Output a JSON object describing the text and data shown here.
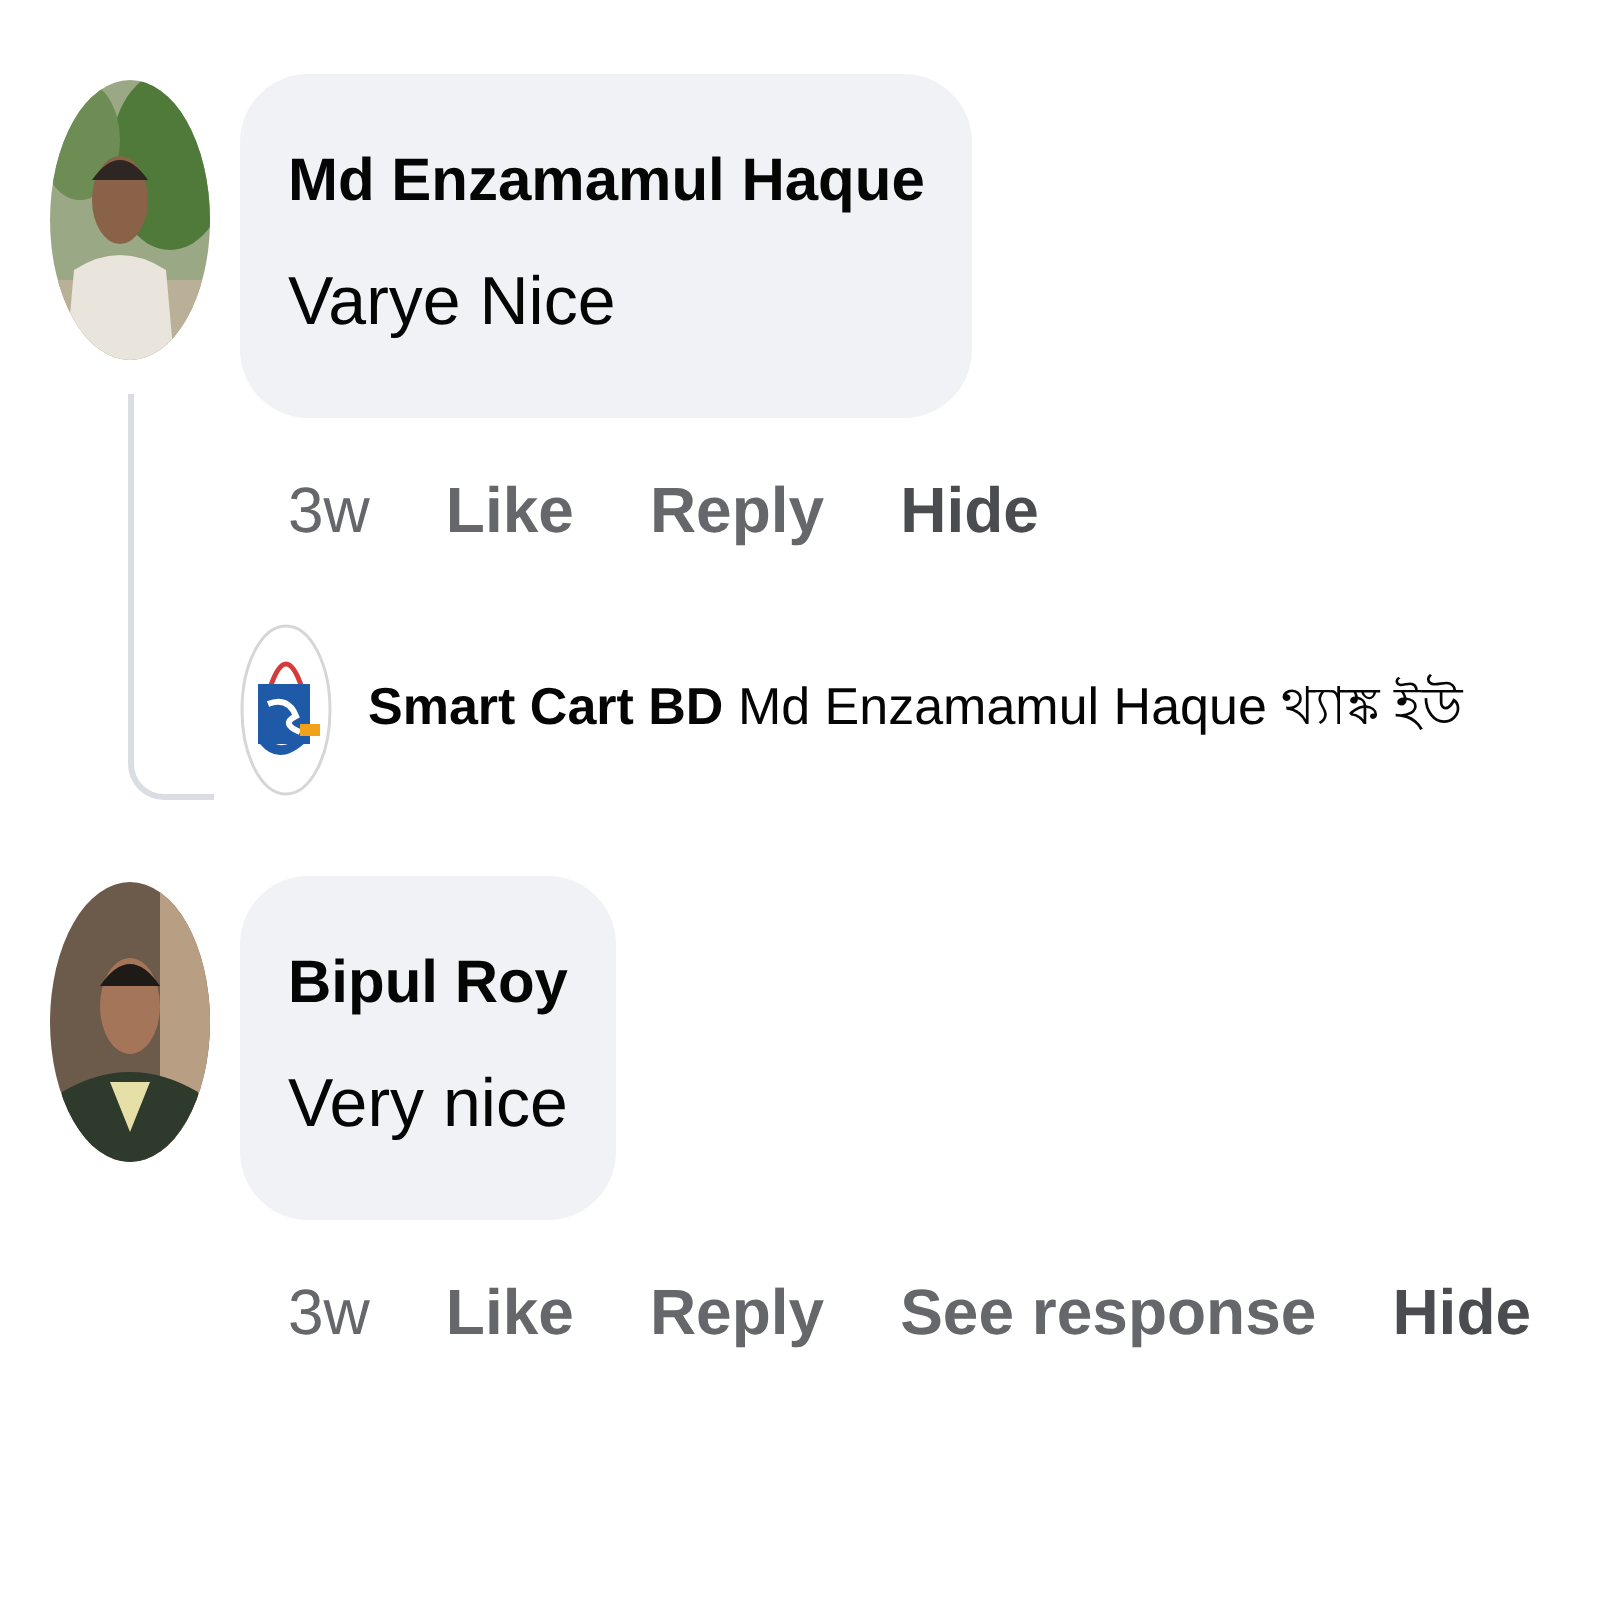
{
  "comments": [
    {
      "avatar": {
        "kind": "picture"
      },
      "author": "Md Enzamamul Haque",
      "text": "Varye Nice",
      "actions": [
        {
          "kind": "time",
          "label": "3w"
        },
        {
          "kind": "action",
          "label": "Like"
        },
        {
          "kind": "action",
          "label": "Reply"
        },
        {
          "kind": "strong",
          "label": "Hide"
        }
      ],
      "replies": [
        {
          "author": "Smart Cart BD",
          "text": "Md Enzamamul Haque থ্যাঙ্ক ইউ"
        }
      ]
    },
    {
      "avatar": {
        "kind": "picture"
      },
      "author": "Bipul Roy",
      "text": "Very nice",
      "actions": [
        {
          "kind": "time",
          "label": "3w"
        },
        {
          "kind": "action",
          "label": "Like"
        },
        {
          "kind": "action",
          "label": "Reply"
        },
        {
          "kind": "action",
          "label": "See response"
        },
        {
          "kind": "strong",
          "label": "Hide"
        }
      ]
    }
  ]
}
